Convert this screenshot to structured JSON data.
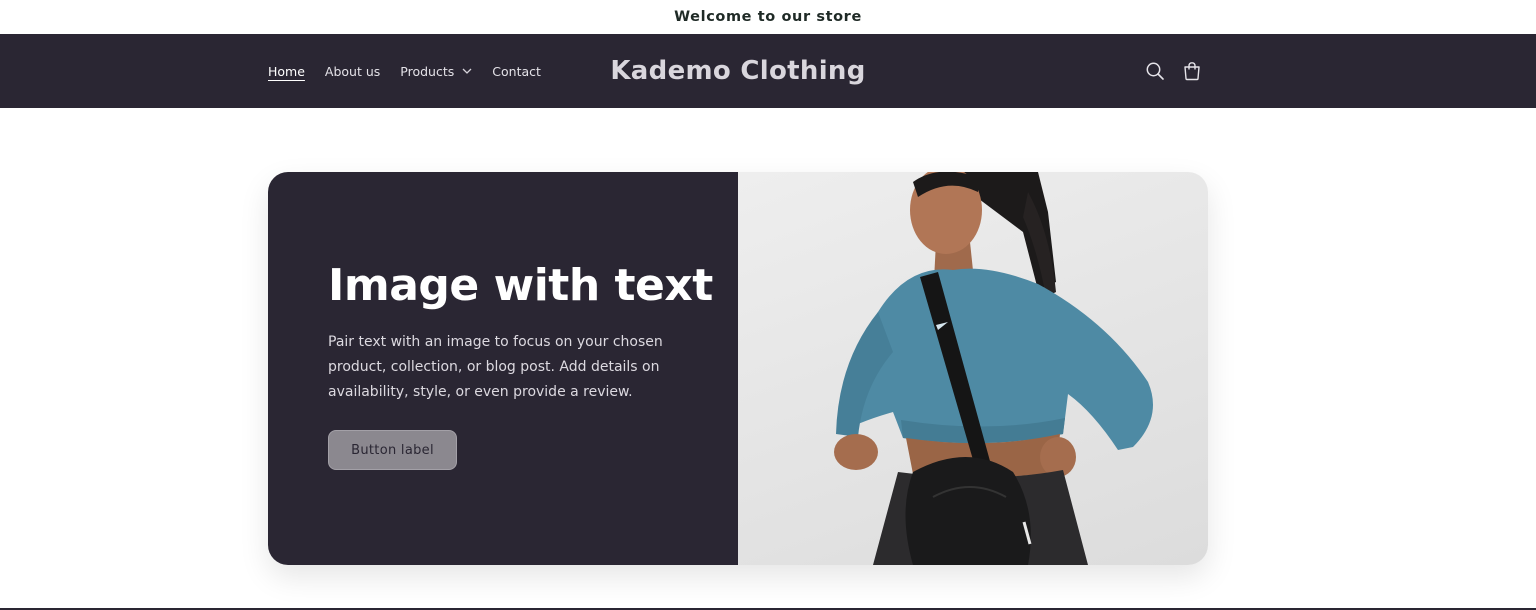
{
  "announcement": {
    "text": "Welcome to our store"
  },
  "header": {
    "nav": [
      {
        "label": "Home",
        "active": true
      },
      {
        "label": "About us"
      },
      {
        "label": "Products",
        "has_dropdown": true
      },
      {
        "label": "Contact"
      }
    ],
    "logo": "Kademo Clothing",
    "icons": [
      "search-icon",
      "cart-icon"
    ],
    "background": "#2a2633"
  },
  "image_with_text": {
    "heading": "Image with text",
    "body": "Pair text with an image to focus on your chosen product, collection, or blog post. Add details on availability, style, or even provide a review.",
    "button_label": "Button label",
    "panel_color": "#2a2633",
    "image_subject": "woman in teal cropped sweatshirt with black crossbody bag"
  }
}
